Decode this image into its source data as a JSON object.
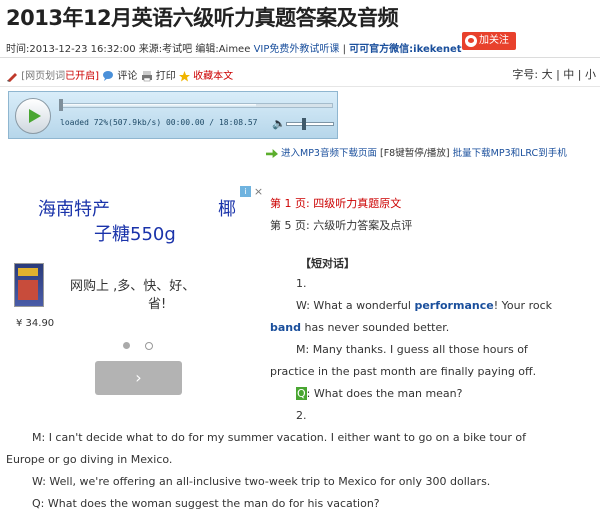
{
  "article": {
    "title": "2013年12月英语六级听力真题答案及音频",
    "time": "时间:2013-12-23 16:32:00",
    "source": "来源:考试吧",
    "editor": "编辑:Aimee",
    "vip": "VIP免费外教试听课",
    "wechat": "可可官方微信:ikekenet"
  },
  "weibo": {
    "label": "加关注"
  },
  "tools": {
    "web_zone": "[网页划词",
    "web_zone_state": "已开启]",
    "comment": "评论",
    "print": "打印",
    "favorite": "收藏本文"
  },
  "font_size": {
    "label": "字号:",
    "large": "大",
    "sep1": "|",
    "medium": "中",
    "sep2": "|",
    "small": "小"
  },
  "player": {
    "status": "loaded 72%(507.9kb/s) 00:00.00 / 18:08.57",
    "progress_fraction": 0.72,
    "icons": {
      "play": "play-icon",
      "volume": "speaker-icon"
    }
  },
  "download": {
    "mp3_page": "进入MP3音频下载页面",
    "shortcut": "[F8键暂停/播放]",
    "batch": "批量下载MP3和LRC到手机"
  },
  "ad": {
    "headline1": "海南特产",
    "headline1b": "椰",
    "headline2": "子糖550g",
    "info_icon": "i",
    "close_icon": "×",
    "desc1": "网购上      ,多、快、好、",
    "desc2": "省!",
    "price": "¥ 34.90",
    "next": "›"
  },
  "pages": [
    {
      "label": "第 1 页:",
      "text": "四级听力真题原文"
    },
    {
      "label": "第 5 页:",
      "text": "六级听力答案及点评"
    }
  ],
  "content": {
    "section": "【短对话】",
    "n1": "1.",
    "w1_a": "W: What a wonderful ",
    "w1_kw1": "performance",
    "w1_b": "! Your rock",
    "w1_kw2": "band",
    "w1_c": " has never sounded better.",
    "m1a": "M: Many thanks. I guess all those hours of",
    "m1b": "practice in the past month are finally paying off.",
    "q1_mark": "Q",
    "q1": ": What does the man mean?",
    "n2": "2.",
    "m2a": "M: I can't decide what to do for my summer vacation. I either want to go on a bike tour of",
    "m2b": "Europe or go diving in Mexico.",
    "w2": "W: Well, we're offering an all-inclusive two-week trip to Mexico for only 300 dollars.",
    "q2": "Q: What does the woman suggest the man do for his vacation?"
  },
  "colors": {
    "link": "#1a4f9c",
    "accent_red": "#c00",
    "weibo": "#e8412c",
    "green": "#49a632"
  }
}
